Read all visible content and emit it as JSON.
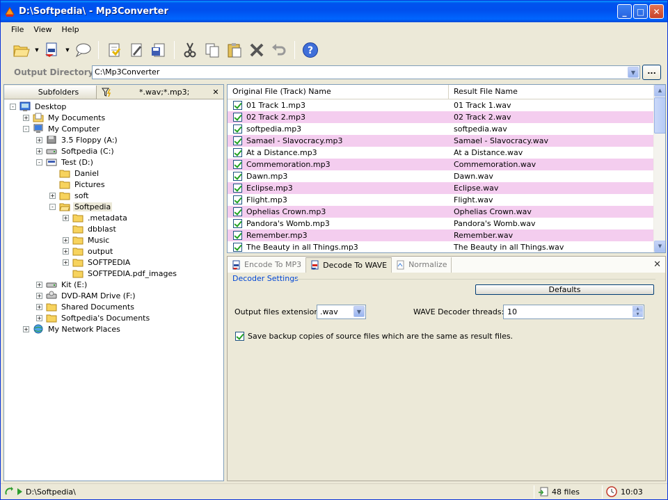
{
  "window": {
    "title": "D:\\Softpedia\\ - Mp3Converter",
    "min_symbol": "_",
    "max_symbol": "□",
    "close_symbol": "✕"
  },
  "menu": [
    "File",
    "View",
    "Help"
  ],
  "toolbar": {
    "icons": [
      "open-folder-icon",
      "batch-icon",
      "comment-icon",
      "copy-to-icon",
      "edit-icon",
      "save-icon",
      "cut-icon",
      "copy-icon",
      "paste-icon",
      "delete-icon",
      "undo-icon",
      "help-icon"
    ]
  },
  "output": {
    "label": "Output Directory:",
    "value": "C:\\Mp3Converter",
    "browse_label": "..."
  },
  "left_pane": {
    "subfolders_label": "Subfolders",
    "filter": "*.wav;*.mp3;",
    "close_label": "✕"
  },
  "tree": [
    {
      "label": "Desktop",
      "exp": "-",
      "icon": "desktop",
      "depth": 0
    },
    {
      "label": "My Documents",
      "exp": "+",
      "icon": "docs",
      "depth": 1
    },
    {
      "label": "My Computer",
      "exp": "-",
      "icon": "computer",
      "depth": 1
    },
    {
      "label": "3.5 Floppy (A:)",
      "exp": "+",
      "icon": "floppy",
      "depth": 2
    },
    {
      "label": "Softpedia (C:)",
      "exp": "+",
      "icon": "drive",
      "depth": 2
    },
    {
      "label": "Test (D:)",
      "exp": "-",
      "icon": "drive2",
      "depth": 2
    },
    {
      "label": "Daniel",
      "exp": "",
      "icon": "folder",
      "depth": 3
    },
    {
      "label": "Pictures",
      "exp": "",
      "icon": "folder",
      "depth": 3
    },
    {
      "label": "soft",
      "exp": "+",
      "icon": "folder",
      "depth": 3
    },
    {
      "label": "Softpedia",
      "exp": "-",
      "icon": "folder-open",
      "depth": 3,
      "selected": true
    },
    {
      "label": ".metadata",
      "exp": "+",
      "icon": "folder",
      "depth": 4
    },
    {
      "label": "dbblast",
      "exp": "",
      "icon": "folder",
      "depth": 4
    },
    {
      "label": "Music",
      "exp": "+",
      "icon": "folder",
      "depth": 4
    },
    {
      "label": "output",
      "exp": "+",
      "icon": "folder",
      "depth": 4
    },
    {
      "label": "SOFTPEDIA",
      "exp": "+",
      "icon": "folder",
      "depth": 4
    },
    {
      "label": "SOFTPEDIA.pdf_images",
      "exp": "",
      "icon": "folder",
      "depth": 4
    },
    {
      "label": "Kit (E:)",
      "exp": "+",
      "icon": "drive",
      "depth": 2
    },
    {
      "label": "DVD-RAM Drive (F:)",
      "exp": "+",
      "icon": "dvd",
      "depth": 2
    },
    {
      "label": "Shared Documents",
      "exp": "+",
      "icon": "folder",
      "depth": 2
    },
    {
      "label": "Softpedia's Documents",
      "exp": "+",
      "icon": "folder",
      "depth": 2
    },
    {
      "label": "My Network Places",
      "exp": "+",
      "icon": "network",
      "depth": 1
    }
  ],
  "file_list": {
    "col1": "Original File (Track) Name",
    "col2": "Result File Name",
    "rows": [
      [
        "01 Track 1.mp3",
        "01 Track 1.wav"
      ],
      [
        "02 Track 2.mp3",
        "02 Track 2.wav"
      ],
      [
        "softpedia.mp3",
        "softpedia.wav"
      ],
      [
        "Samael - Slavocracy.mp3",
        "Samael - Slavocracy.wav"
      ],
      [
        "At a Distance.mp3",
        "At a Distance.wav"
      ],
      [
        "Commemoration.mp3",
        "Commemoration.wav"
      ],
      [
        "Dawn.mp3",
        "Dawn.wav"
      ],
      [
        "Eclipse.mp3",
        "Eclipse.wav"
      ],
      [
        "Flight.mp3",
        "Flight.wav"
      ],
      [
        "Ophelias Crown.mp3",
        "Ophelias Crown.wav"
      ],
      [
        "Pandora's Womb.mp3",
        "Pandora's Womb.wav"
      ],
      [
        "Remember.mp3",
        "Remember.wav"
      ],
      [
        "The Beauty in all Things.mp3",
        "The Beauty in all Things.wav"
      ]
    ]
  },
  "settings": {
    "tabs": [
      "Encode To MP3",
      "Decode To WAVE",
      "Normalize"
    ],
    "active_tab": 1,
    "close_label": "✕",
    "group_label": "Decoder Settings",
    "defaults_label": "Defaults",
    "ext_label": "Output files extension:",
    "ext_value": ".wav",
    "threads_label": "WAVE Decoder threads:",
    "threads_value": "10",
    "backup_label": "Save backup copies of source files which are the same as result files."
  },
  "status": {
    "path": "D:\\Softpedia\\",
    "files": "48 files",
    "time": "10:03"
  },
  "colors": {
    "title_bar": "#0053ee",
    "alt_row": "#f4cdef",
    "group_label": "#0046d5"
  }
}
